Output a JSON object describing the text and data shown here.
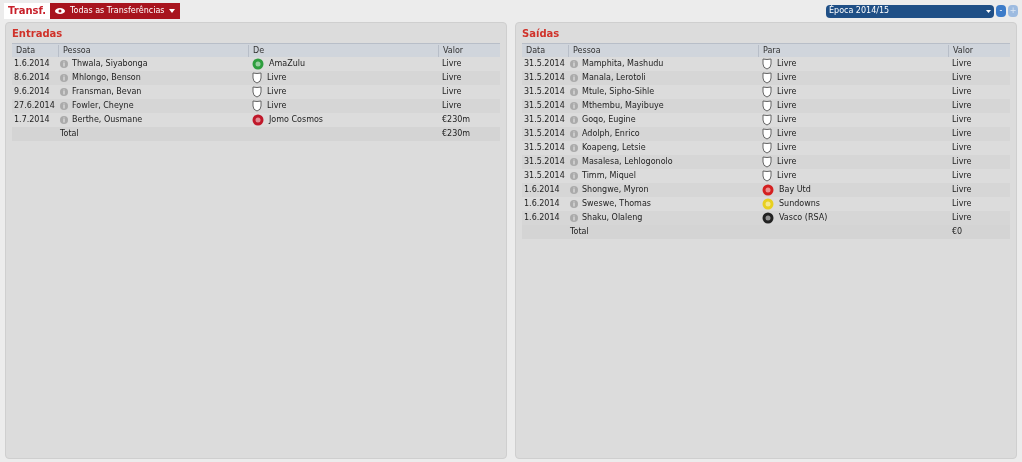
{
  "header": {
    "title": "Transf.",
    "filter": {
      "label": "Todas as Transferências"
    },
    "season": {
      "value": "Época 2014/15"
    },
    "steppers": [
      {
        "label": "-",
        "disabled": false
      },
      {
        "label": "+",
        "disabled": true
      }
    ]
  },
  "panels": [
    {
      "title": "Entradas",
      "columns": [
        "Data",
        "Pessoa",
        "De",
        "Valor"
      ],
      "rows": [
        {
          "date": "1.6.2014",
          "person": "Thwala, Siyabonga",
          "club": "AmaZulu",
          "crest": {
            "kind": "emblem",
            "color": "#2e9e3e"
          },
          "value": "Livre"
        },
        {
          "date": "8.6.2014",
          "person": "Mhlongo, Benson",
          "club": "Livre",
          "crest": {
            "kind": "shield"
          },
          "value": "Livre"
        },
        {
          "date": "9.6.2014",
          "person": "Fransman, Bevan",
          "club": "Livre",
          "crest": {
            "kind": "shield"
          },
          "value": "Livre"
        },
        {
          "date": "27.6.2014",
          "person": "Fowler, Cheyne",
          "club": "Livre",
          "crest": {
            "kind": "shield"
          },
          "value": "Livre"
        },
        {
          "date": "1.7.2014",
          "person": "Berthe, Ousmane",
          "club": "Jomo Cosmos",
          "crest": {
            "kind": "emblem",
            "color": "#c0182a"
          },
          "value": "€230m"
        }
      ],
      "total": {
        "label": "Total",
        "value": "€230m"
      }
    },
    {
      "title": "Saídas",
      "columns": [
        "Data",
        "Pessoa",
        "Para",
        "Valor"
      ],
      "rows": [
        {
          "date": "31.5.2014",
          "person": "Mamphita, Mashudu",
          "club": "Livre",
          "crest": {
            "kind": "shield"
          },
          "value": "Livre"
        },
        {
          "date": "31.5.2014",
          "person": "Manala, Lerotoli",
          "club": "Livre",
          "crest": {
            "kind": "shield"
          },
          "value": "Livre"
        },
        {
          "date": "31.5.2014",
          "person": "Mtule, Sipho-Sihle",
          "club": "Livre",
          "crest": {
            "kind": "shield"
          },
          "value": "Livre"
        },
        {
          "date": "31.5.2014",
          "person": "Mthembu, Mayibuye",
          "club": "Livre",
          "crest": {
            "kind": "shield"
          },
          "value": "Livre"
        },
        {
          "date": "31.5.2014",
          "person": "Goqo, Eugine",
          "club": "Livre",
          "crest": {
            "kind": "shield"
          },
          "value": "Livre"
        },
        {
          "date": "31.5.2014",
          "person": "Adolph, Enrico",
          "club": "Livre",
          "crest": {
            "kind": "shield"
          },
          "value": "Livre"
        },
        {
          "date": "31.5.2014",
          "person": "Koapeng, Letsie",
          "club": "Livre",
          "crest": {
            "kind": "shield"
          },
          "value": "Livre"
        },
        {
          "date": "31.5.2014",
          "person": "Masalesa, Lehlogonolo",
          "club": "Livre",
          "crest": {
            "kind": "shield"
          },
          "value": "Livre"
        },
        {
          "date": "31.5.2014",
          "person": "Timm, Miquel",
          "club": "Livre",
          "crest": {
            "kind": "shield"
          },
          "value": "Livre"
        },
        {
          "date": "1.6.2014",
          "person": "Shongwe, Myron",
          "club": "Bay Utd",
          "crest": {
            "kind": "emblem",
            "color": "#d42020"
          },
          "value": "Livre"
        },
        {
          "date": "1.6.2014",
          "person": "Sweswe, Thomas",
          "club": "Sundowns",
          "crest": {
            "kind": "emblem",
            "color": "#e8d020"
          },
          "value": "Livre"
        },
        {
          "date": "1.6.2014",
          "person": "Shaku, Olaleng",
          "club": "Vasco (RSA)",
          "crest": {
            "kind": "emblem",
            "color": "#222222"
          },
          "value": "Livre"
        }
      ],
      "total": {
        "label": "Total",
        "value": "€0"
      }
    }
  ]
}
